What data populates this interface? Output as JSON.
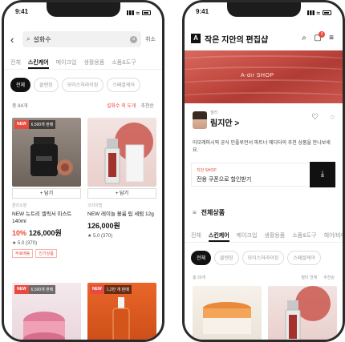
{
  "left": {
    "status_time": "9:41",
    "search": {
      "query": "설화수",
      "cancel": "취소"
    },
    "tabs": [
      "전체",
      "스킨케어",
      "메이크업",
      "생활용품",
      "소품&도구"
    ],
    "chips": [
      "전체",
      "클렌징",
      "모이스처라이징",
      "스페셜케어"
    ],
    "count": "총 84개",
    "sort": {
      "filter": "설화수 외 두개",
      "order": "추천순"
    },
    "products": [
      {
        "badge_new": "NEW",
        "badge_rank": "6,500개 판매",
        "cart": "+ 담기",
        "brand": "클리오맨",
        "name": "NEW 뉴트리 엘릭서 미스트 140ml",
        "discount": "10%",
        "price": "126,000원",
        "rating": "5.0 (370)",
        "tags": [
          "무료배송",
          "인기상품"
        ]
      },
      {
        "cart": "+ 담기",
        "brand": "코리아랩",
        "name": "NEW 레이놀 볼륨 립 세럼 12g",
        "price": "126,000원",
        "rating": "5.0 (370)"
      },
      {
        "badge_new": "NEW",
        "badge_rank": "6,500개 판매"
      },
      {
        "badge_new": "NEW",
        "badge_rank": "1,2만 개 판매"
      }
    ]
  },
  "right": {
    "status_time": "9:41",
    "logo": "A",
    "title": "작은 지안의 편집샵",
    "cart_count": "3",
    "banner_text": "A-dir SHOP",
    "profile": {
      "role": "셀러",
      "name": "림지안 >",
      "desc": "아모레퍼시픽 공식 인플루언서 파트너 에디터의 추천 상품을 만나보세요."
    },
    "coupon": {
      "label": "지안 SHOP",
      "text": "전용 쿠폰으로 할인받기"
    },
    "section_title": "전체상품",
    "tabs": [
      "전체",
      "스킨케어",
      "메이크업",
      "생활용품",
      "소품&도구",
      "헤어/바디"
    ],
    "chips": [
      "전체",
      "클렌징",
      "모이스처라이징",
      "스페셜케어"
    ],
    "sort": {
      "count": "총 20개",
      "filter": "필터 전체",
      "order": "추천순"
    }
  }
}
